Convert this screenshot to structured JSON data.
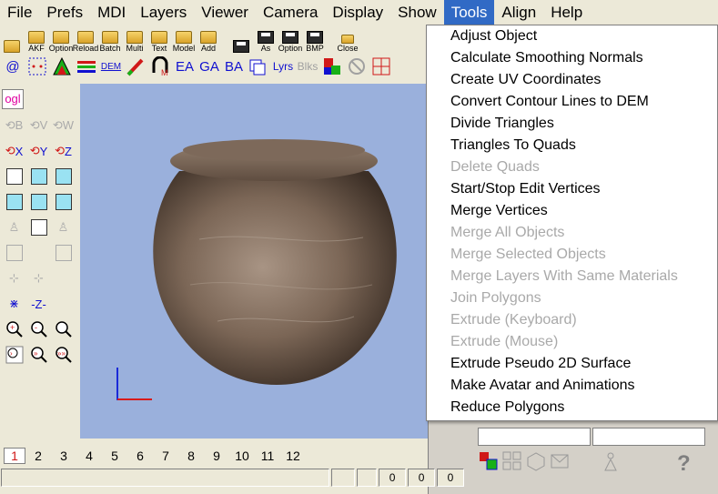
{
  "menubar": {
    "items": [
      "File",
      "Prefs",
      "MDI",
      "Layers",
      "Viewer",
      "Camera",
      "Display",
      "Show",
      "Tools",
      "Align",
      "Help"
    ],
    "active_index": 8
  },
  "toolbar1": {
    "buttons": [
      "AKF",
      "Option",
      "Reload",
      "Batch",
      "Multi",
      "Text",
      "Model",
      "Add",
      "",
      "As",
      "Option",
      "BMP",
      "Close"
    ]
  },
  "toolbar2": {
    "buttons": [
      "@",
      "",
      "",
      "",
      "DEM",
      "",
      "",
      "EA",
      "GA",
      "BA",
      "",
      "Lyrs",
      "Blks",
      "",
      "",
      ""
    ]
  },
  "leftbar": {
    "ogl_label": "ogl"
  },
  "tools_menu": {
    "items": [
      {
        "label": "Adjust Object",
        "enabled": true
      },
      {
        "label": "Calculate Smoothing Normals",
        "enabled": true
      },
      {
        "label": "Create UV Coordinates",
        "enabled": true
      },
      {
        "label": "Convert Contour Lines to DEM",
        "enabled": true
      },
      {
        "label": "Divide Triangles",
        "enabled": true
      },
      {
        "label": "Triangles To Quads",
        "enabled": true
      },
      {
        "label": "Delete Quads",
        "enabled": false
      },
      {
        "label": "Start/Stop Edit Vertices",
        "enabled": true
      },
      {
        "label": "Merge Vertices",
        "enabled": true
      },
      {
        "label": "Merge All Objects",
        "enabled": false
      },
      {
        "label": "Merge Selected Objects",
        "enabled": false
      },
      {
        "label": "Merge Layers With Same Materials",
        "enabled": false
      },
      {
        "label": "Join Polygons",
        "enabled": false
      },
      {
        "label": "Extrude (Keyboard)",
        "enabled": false
      },
      {
        "label": "Extrude (Mouse)",
        "enabled": false
      },
      {
        "label": "Extrude Pseudo 2D Surface",
        "enabled": true
      },
      {
        "label": "Make Avatar and Animations",
        "enabled": true
      },
      {
        "label": "Reduce Polygons",
        "enabled": true
      }
    ]
  },
  "layers": {
    "numbers": [
      "1",
      "2",
      "3",
      "4",
      "5",
      "6",
      "7",
      "8",
      "9",
      "10",
      "11",
      "12"
    ],
    "active": "1"
  },
  "statusbar": {
    "values": [
      "0",
      "0",
      "0"
    ]
  },
  "right_panel": {
    "help_label": "?"
  },
  "colors": {
    "menu_highlight": "#316ac5",
    "viewport_bg": "#9ab0dc",
    "disabled_text": "#a9a9a9",
    "active_layer": "#d01818"
  }
}
